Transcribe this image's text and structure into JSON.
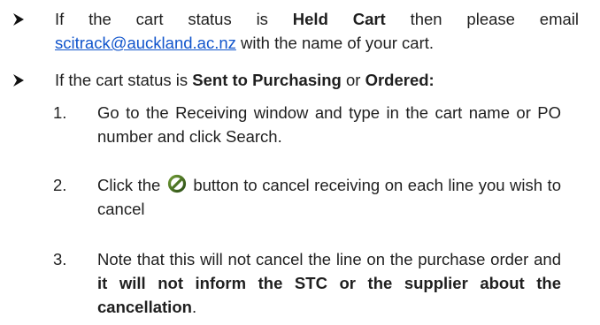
{
  "bullets": [
    {
      "text_1": "If the cart status is ",
      "bold_1": "Held Cart",
      "text_2": " then please email ",
      "email": "scitrack@auckland.ac.nz",
      "text_3": " with the name of your cart."
    },
    {
      "text_1": "If the cart status is ",
      "bold_1": "Sent to Purchasing",
      "text_2": " or ",
      "bold_2": "Ordered:"
    }
  ],
  "steps": [
    {
      "number": "1.",
      "text": "Go to the Receiving window and type in the cart name or PO number and click Search."
    },
    {
      "number": "2.",
      "text_before_icon": "Click the ",
      "icon": "cancel-circle-icon",
      "text_after_icon": " button to cancel receiving on each line you wish to cancel"
    },
    {
      "number": "3.",
      "text_1": "Note that this will not cancel the line on the purchase order and ",
      "bold_1": "it will not inform the STC or the supplier about the cancellation",
      "text_2": "."
    }
  ],
  "colors": {
    "text": "#1f1f1f",
    "link": "#1155cc",
    "icon_fill": "#2b4e16",
    "icon_highlight": "#6f9a34"
  }
}
